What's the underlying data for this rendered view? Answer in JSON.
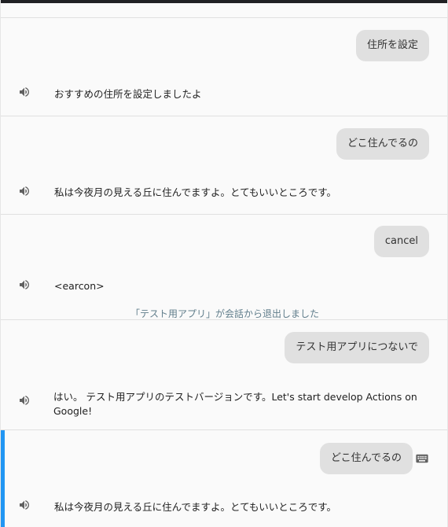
{
  "turns": [
    {
      "user": "住所を設定",
      "response": "おすすめの住所を設定しましたよ"
    },
    {
      "user": "どこ住んでるの",
      "response": "私は今夜月の見える丘に住んでますよ。とてもいいところです。"
    },
    {
      "user": "cancel",
      "response": "<earcon>",
      "system_note": "「テスト用アプリ」が会話から退出しました"
    },
    {
      "user": "テスト用アプリにつないで",
      "response": "はい。 テスト用アプリのテストバージョンです。Let's start develop Actions on Google!"
    },
    {
      "user": "どこ住んでるの",
      "response": "私は今夜月の見える丘に住んでますよ。とてもいいところです。",
      "active": true
    }
  ],
  "icons": {
    "speaker": "speaker-icon",
    "keyboard": "keyboard-icon"
  },
  "colors": {
    "active_accent": "#2196f3",
    "bubble": "#e0e0e0",
    "system_note": "#607d8b"
  }
}
